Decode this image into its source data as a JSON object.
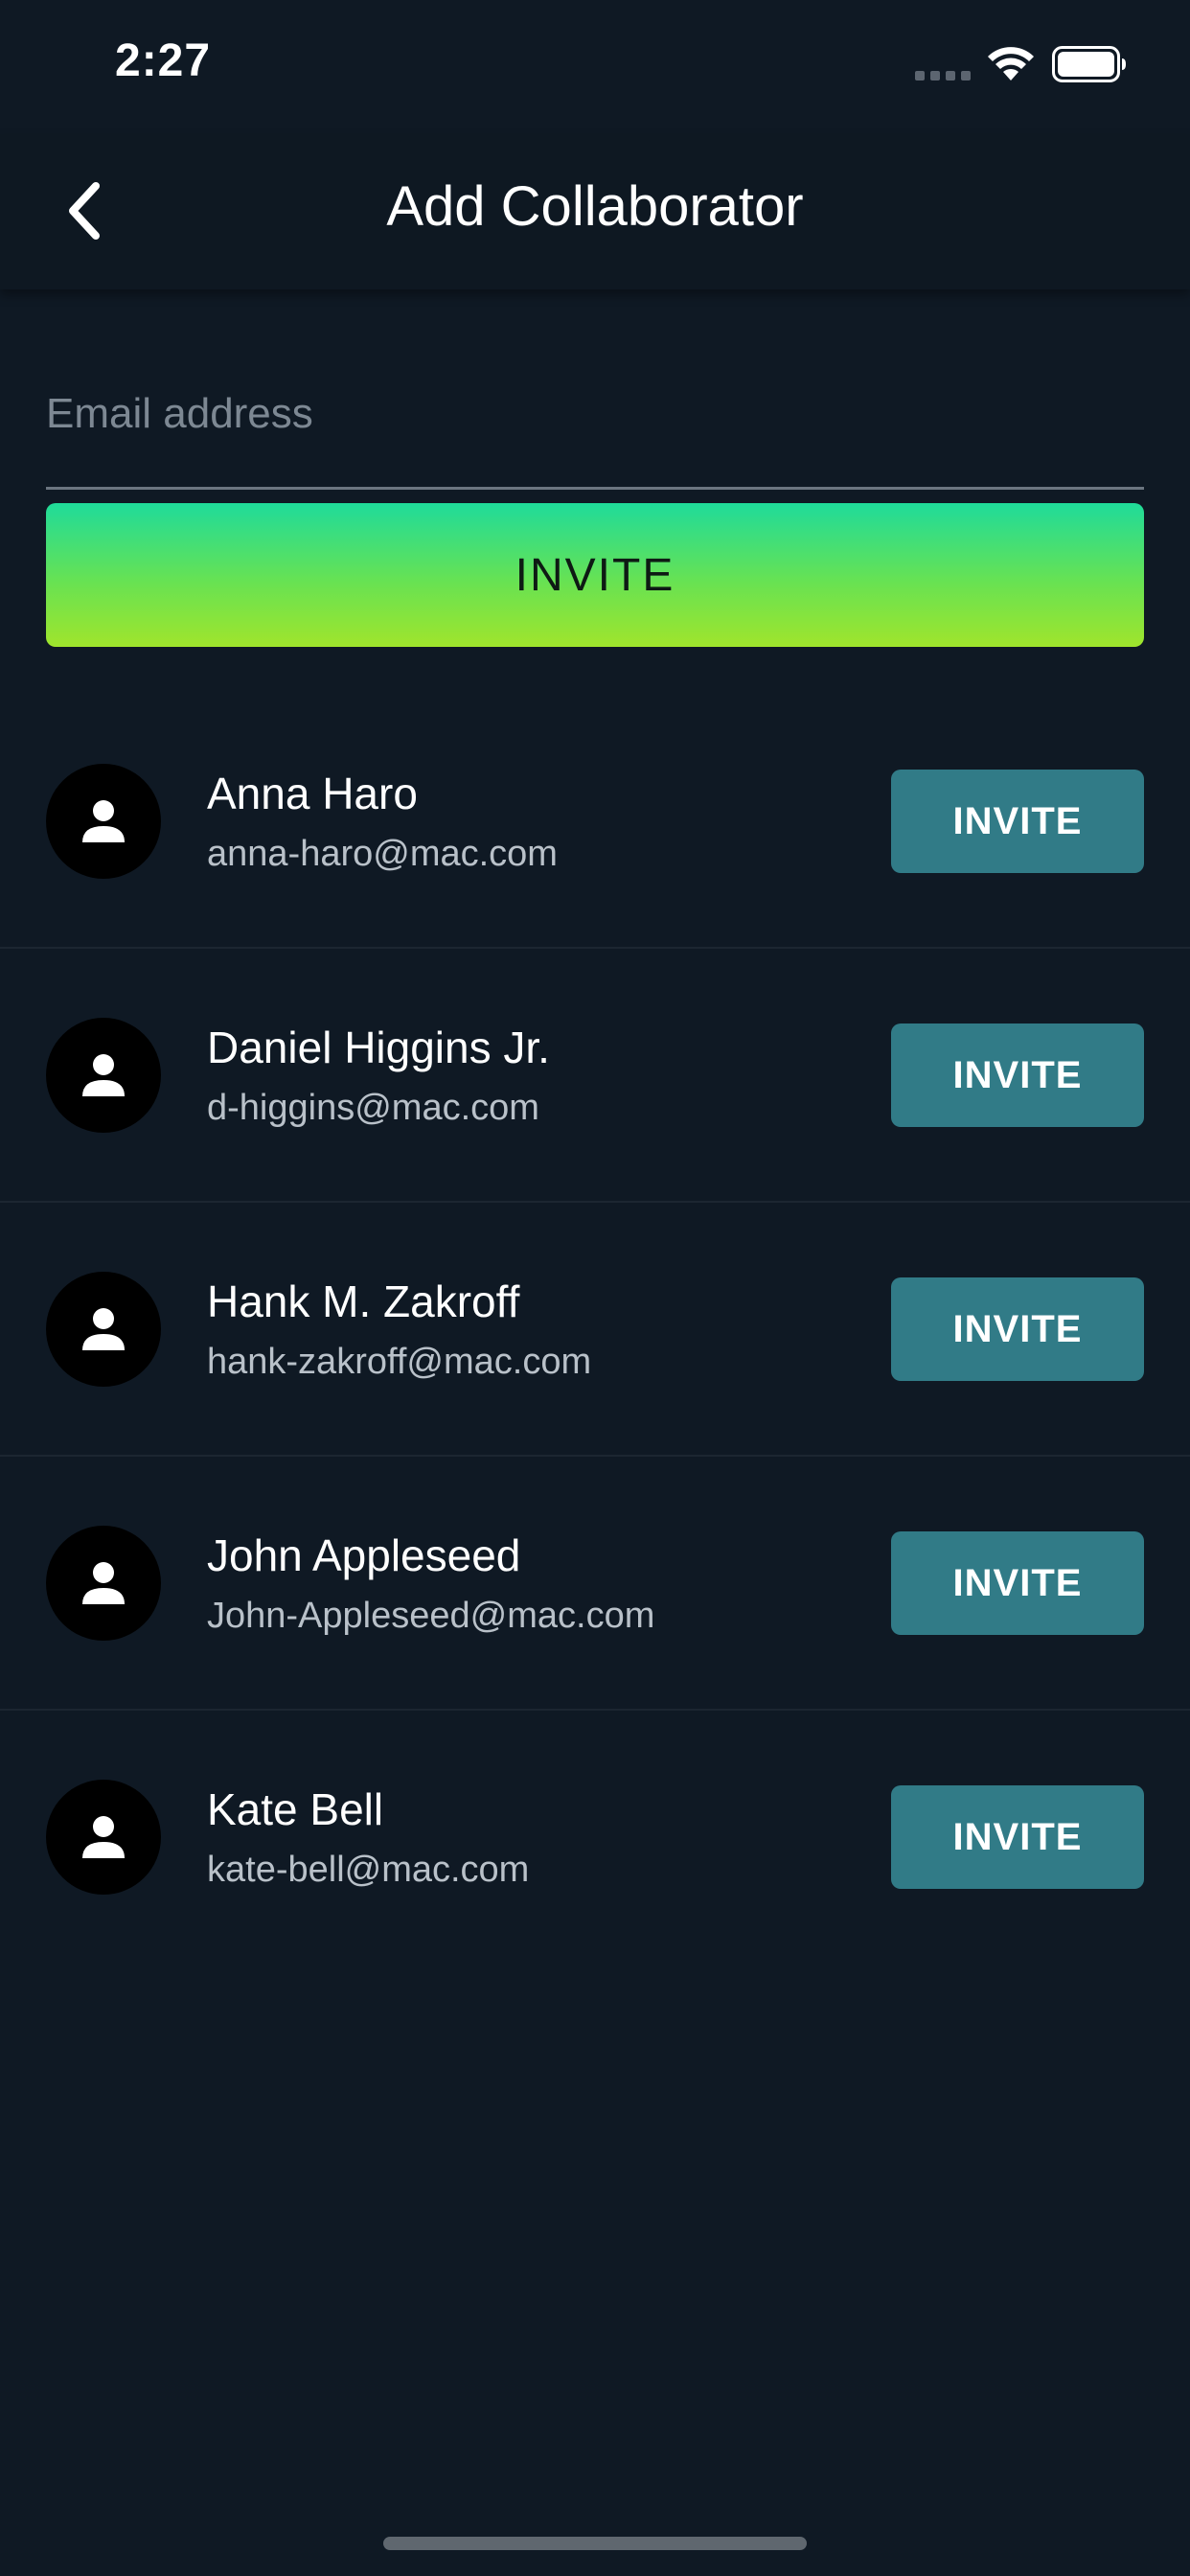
{
  "status_bar": {
    "time": "2:27",
    "signal_icon": "cellular-signal-icon",
    "wifi_icon": "wifi-icon",
    "battery_icon": "battery-full-icon"
  },
  "header": {
    "back_icon": "chevron-left-icon",
    "title": "Add Collaborator"
  },
  "invite_form": {
    "email_placeholder": "Email address",
    "email_value": "",
    "invite_label": "INVITE"
  },
  "contacts": [
    {
      "name": "Anna Haro",
      "email": "anna-haro@mac.com",
      "button_label": "INVITE",
      "avatar_icon": "person-icon"
    },
    {
      "name": "Daniel Higgins Jr.",
      "email": "d-higgins@mac.com",
      "button_label": "INVITE",
      "avatar_icon": "person-icon"
    },
    {
      "name": "Hank M. Zakroff",
      "email": "hank-zakroff@mac.com",
      "button_label": "INVITE",
      "avatar_icon": "person-icon"
    },
    {
      "name": "John Appleseed",
      "email": "John-Appleseed@mac.com",
      "button_label": "INVITE",
      "avatar_icon": "person-icon"
    },
    {
      "name": "Kate Bell",
      "email": "kate-bell@mac.com",
      "button_label": "INVITE",
      "avatar_icon": "person-icon"
    }
  ],
  "colors": {
    "background": "#0f1924",
    "invite_gradient_top": "#1fdb9a",
    "invite_gradient_bottom": "#a0e52c",
    "row_button": "#317b87"
  }
}
